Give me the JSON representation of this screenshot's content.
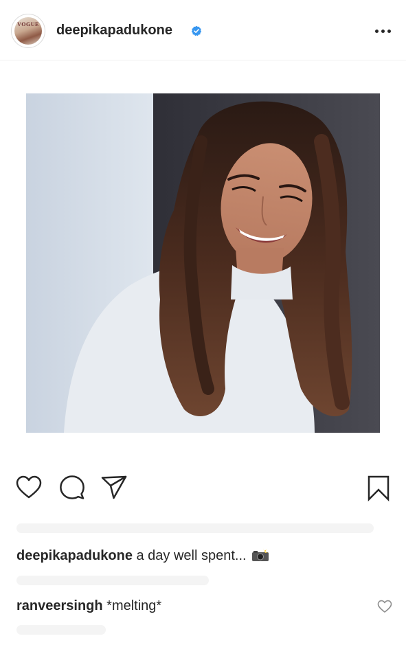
{
  "post": {
    "username": "deepikapadukone",
    "verified": true,
    "avatar_text": "VOGUE",
    "more_icon": "more-horizontal-icon"
  },
  "actions": {
    "like_icon": "heart-outline-icon",
    "comment_icon": "comment-bubble-icon",
    "share_icon": "paper-plane-icon",
    "save_icon": "bookmark-outline-icon"
  },
  "caption": {
    "username": "deepikapadukone",
    "text": "a day well spent...",
    "emoji_icon": "camera-flash-icon"
  },
  "comment": {
    "username": "ranveersingh",
    "text": "*melting*",
    "like_icon": "heart-small-icon"
  },
  "colors": {
    "text": "#262626",
    "verified_blue": "#3897f0",
    "divider": "#efefef"
  }
}
